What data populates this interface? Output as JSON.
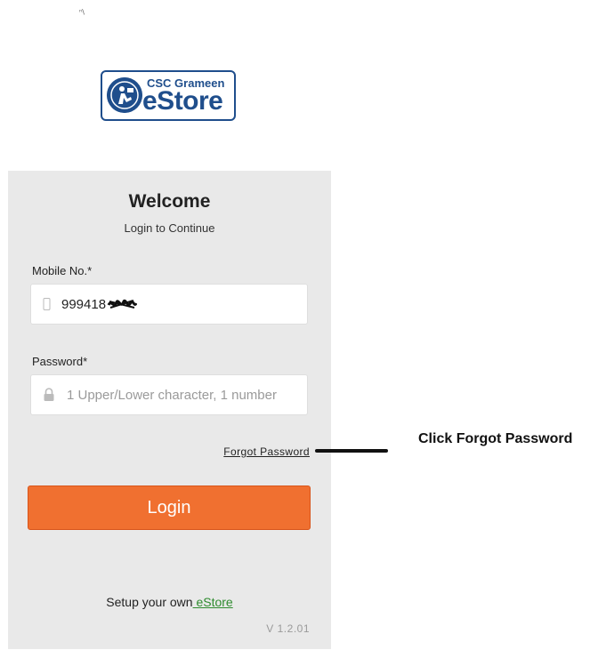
{
  "status_mark": "ⁿ\\",
  "logo": {
    "line1": "CSC Grameen",
    "line2": "eStore"
  },
  "login_card": {
    "title": "Welcome",
    "subtitle": "Login to Continue",
    "mobile": {
      "label": "Mobile No.*",
      "value": "999418",
      "icon": "phone-icon"
    },
    "password": {
      "label": "Password*",
      "placeholder": "1 Upper/Lower character, 1 number",
      "icon": "lock-icon"
    },
    "forgot_password": "Forgot Password",
    "login_button": "Login",
    "setup_text": "Setup your own",
    "setup_link": " eStore",
    "version": "V 1.2.01"
  },
  "annotation": {
    "text": "Click Forgot Password"
  },
  "colors": {
    "accent": "#f07030",
    "link": "#2e8b2e",
    "brand": "#1f4e8c",
    "card_bg": "#e9e9e9"
  }
}
